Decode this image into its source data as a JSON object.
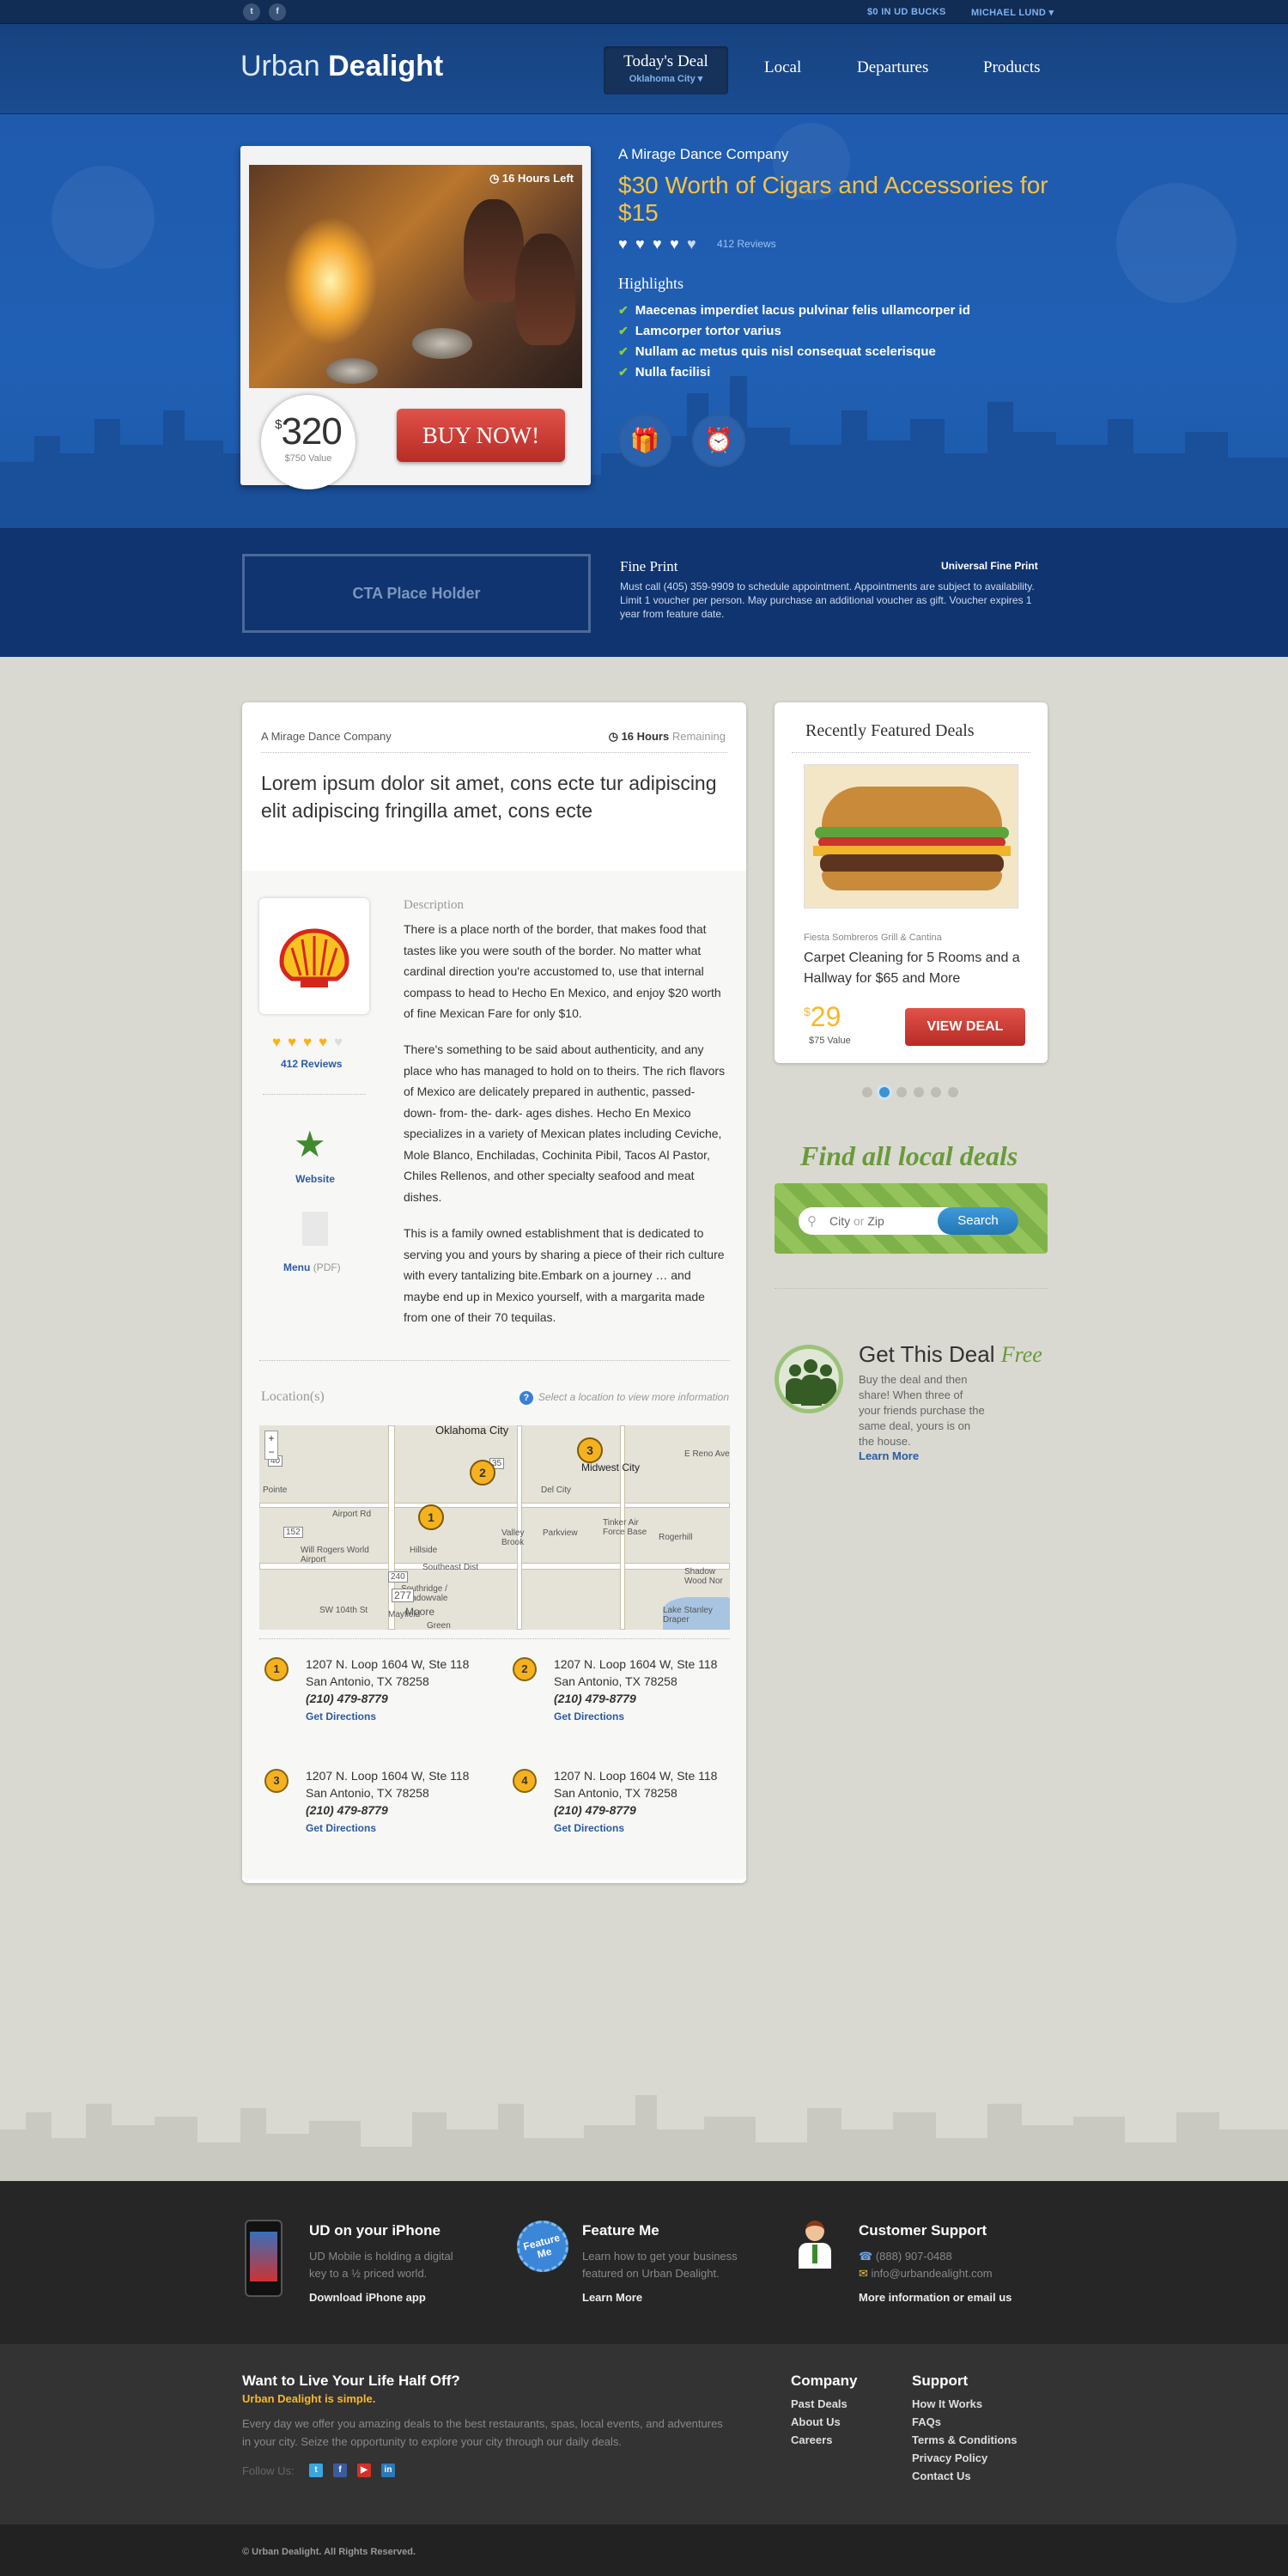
{
  "topbar": {
    "ud_bucks": "$0 IN UD BUCKS",
    "user": "MICHAEL LUND ▾"
  },
  "header": {
    "logo_light": "Urban",
    "logo_bold": "Dealight",
    "nav": {
      "today_label": "Today's Deal",
      "city": "Oklahoma City ▾",
      "local": "Local",
      "departures": "Departures",
      "products": "Products"
    }
  },
  "hero": {
    "hours_left": "16 Hours Left",
    "price": "320",
    "currency": "$",
    "value": "$750 Value",
    "buy_label": "BUY NOW!",
    "company": "A Mirage Dance Company",
    "title": "$30 Worth of Cigars and Accessories for $15",
    "rating": 4.5,
    "reviews": "412 Reviews",
    "highlights_title": "Highlights",
    "highlights": [
      "Maecenas imperdiet lacus pulvinar felis ullamcorper id",
      "Lamcorper tortor varius",
      "Nullam ac metus quis nisl consequat scelerisque",
      "Nulla facilisi"
    ]
  },
  "fineprint": {
    "cta": "CTA Place Holder",
    "title": "Fine Print",
    "universal": "Universal Fine Print",
    "text": "Must call (405) 359-9909 to schedule appointment. Appointments are subject to availability. Limit 1 voucher per person. May purchase an additional voucher as gift. Voucher expires 1 year from feature date."
  },
  "deal": {
    "company": "A Mirage Dance Company",
    "hours": "16 Hours",
    "remaining": "Remaining",
    "title": "Lorem ipsum dolor sit amet, cons ecte tur adipiscing elit adipiscing fringilla amet, cons ecte",
    "reviews": "412 Reviews",
    "rating": 4,
    "website": "Website",
    "menu": "Menu",
    "menu_type": "(PDF)",
    "description_title": "Description",
    "description": [
      "There is a place north of the border, that makes food that tastes like you were south of the border. No matter what cardinal direction you're accustomed to, use that internal compass to head to Hecho En Mexico, and enjoy $20 worth of fine Mexican Fare for only $10.",
      "There's something to be said about authenticity, and any place who has managed to hold on to theirs. The rich flavors of Mexico are delicately prepared in authentic, passed- down- from- the- dark- ages dishes. Hecho En Mexico specializes in a variety of Mexican plates including Ceviche, Mole Blanco, Enchiladas, Cochinita Pibil, Tacos Al Pastor, Chiles Rellenos, and other specialty seafood and meat dishes.",
      "This is a family owned establishment that is dedicated to serving you and yours by sharing a piece of their rich culture with every tantalizing bite.Embark on a journey … and maybe end up in Mexico yourself, with a margarita made from one of their 70 tequilas."
    ],
    "locations_title": "Location(s)",
    "locations_hint": "Select a location to view more information",
    "map_labels": [
      "Oklahoma City",
      "Midwest City",
      "Del City",
      "Tinker Air Force Base",
      "Valley Brook",
      "Will Rogers World Airport",
      "Southeast Dist",
      "Moore",
      "Pointe",
      "Lake Stanley Draper",
      "Shadow Wood Nor",
      "Rogerhill",
      "E Reno Ave",
      "Southridge / Shadowvale",
      "Mayfield",
      "Airport Rd",
      "Hillside",
      "Parkview",
      "SW 104th St",
      "Green"
    ],
    "map_road_numbers": [
      "152",
      "240",
      "277",
      "35",
      "40",
      "3",
      "1",
      "2",
      "3"
    ],
    "locations": [
      {
        "n": "1",
        "line1": "1207 N. Loop 1604 W, Ste 118",
        "line2": "San Antonio, TX 78258",
        "phone": "(210) 479-8779",
        "dir": "Get Directions"
      },
      {
        "n": "2",
        "line1": "1207 N. Loop 1604 W, Ste 118",
        "line2": "San Antonio, TX 78258",
        "phone": "(210) 479-8779",
        "dir": "Get Directions"
      },
      {
        "n": "3",
        "line1": "1207 N. Loop 1604 W, Ste 118",
        "line2": "San Antonio, TX 78258",
        "phone": "(210) 479-8779",
        "dir": "Get Directions"
      },
      {
        "n": "4",
        "line1": "1207 N. Loop 1604 W, Ste 118",
        "line2": "San Antonio, TX 78258",
        "phone": "(210) 479-8779",
        "dir": "Get Directions"
      }
    ]
  },
  "featured": {
    "title": "Recently Featured Deals",
    "company": "Fiesta Sombreros Grill & Cantina",
    "name": "Carpet Cleaning for 5 Rooms and a Hallway for $65 and More",
    "price": "29",
    "currency": "$",
    "value": "$75 Value",
    "button": "VIEW DEAL",
    "pages": 6,
    "active_page": 2
  },
  "find": {
    "title": "Find all local deals",
    "placeholder_a": "City",
    "placeholder_or": "or",
    "placeholder_b": "Zip",
    "button": "Search"
  },
  "getthis": {
    "title": "Get This Deal",
    "title_em": "Free",
    "text": "Buy the deal and then share! When three of your friends purchase the same deal, yours is on the house.",
    "link": "Learn More"
  },
  "footer": {
    "iphone_title": "UD on your iPhone",
    "iphone_text": "UD Mobile is holding a digital key to a ½ priced world.",
    "iphone_link": "Download iPhone app",
    "feature_badge": "Feature Me",
    "feature_title": "Feature Me",
    "feature_text": "Learn how to get your business featured on Urban Dealight.",
    "feature_link": "Learn More",
    "support_title": "Customer Support",
    "support_phone": "(888) 907-0488",
    "support_email": "info@urbandealight.com",
    "support_link": "More information or email us",
    "tagline_title": "Want to Live Your Life Half Off?",
    "tagline_sub": "Urban Dealight is simple.",
    "tagline_text": "Every day we offer you amazing deals to the best restaurants, spas, local events, and adventures in your city. Seize the opportunity to explore your city through our daily deals.",
    "follow": "Follow Us:",
    "company_title": "Company",
    "company_links": [
      "Past Deals",
      "About Us",
      "Careers"
    ],
    "support_col_title": "Support",
    "support_links": [
      "How It Works",
      "FAQs",
      "Terms & Conditions",
      "Privacy Policy",
      "Contact Us"
    ],
    "copyright": "© Urban Dealight. All Rights Reserved."
  }
}
